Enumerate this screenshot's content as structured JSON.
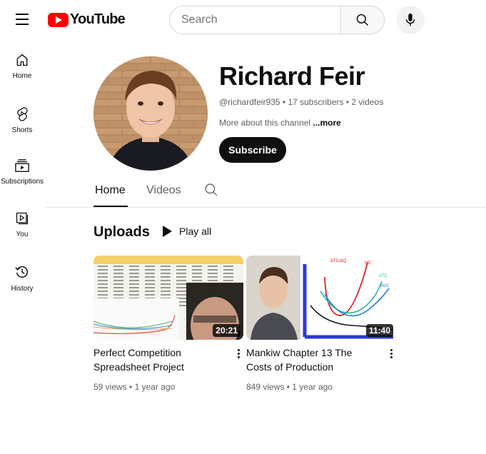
{
  "header": {
    "logo_text": "YouTube",
    "search_placeholder": "Search"
  },
  "sidebar": {
    "items": [
      {
        "label": "Home",
        "icon": "home-icon"
      },
      {
        "label": "Shorts",
        "icon": "shorts-icon"
      },
      {
        "label": "Subscriptions",
        "icon": "subscriptions-icon"
      },
      {
        "label": "You",
        "icon": "you-icon"
      },
      {
        "label": "History",
        "icon": "history-icon"
      }
    ]
  },
  "channel": {
    "name": "Richard Feir",
    "handle": "@richardfeir935",
    "subscribers": "17 subscribers",
    "videos": "2 videos",
    "about": "More about this channel",
    "more_label": "...more",
    "subscribe_label": "Subscribe"
  },
  "tabs": [
    {
      "label": "Home",
      "active": true
    },
    {
      "label": "Videos",
      "active": false
    }
  ],
  "section": {
    "title": "Uploads",
    "play_all_label": "Play all"
  },
  "videos": [
    {
      "title": "Perfect Competition Spreadsheet Project",
      "duration": "20:21",
      "views": "59 views",
      "age": "1 year ago"
    },
    {
      "title": "Mankiw Chapter 13 The Costs of Production",
      "duration": "11:40",
      "views": "849 views",
      "age": "1 year ago"
    }
  ],
  "thumb_chart": {
    "title": "ΔTC/ΔQ",
    "curves": [
      "MC",
      "ATC",
      "AVC"
    ]
  },
  "colors": {
    "brand": "#ff0000",
    "subscribe_bg": "#0f0f0f",
    "text": "#0f0f0f",
    "meta": "#606060"
  }
}
